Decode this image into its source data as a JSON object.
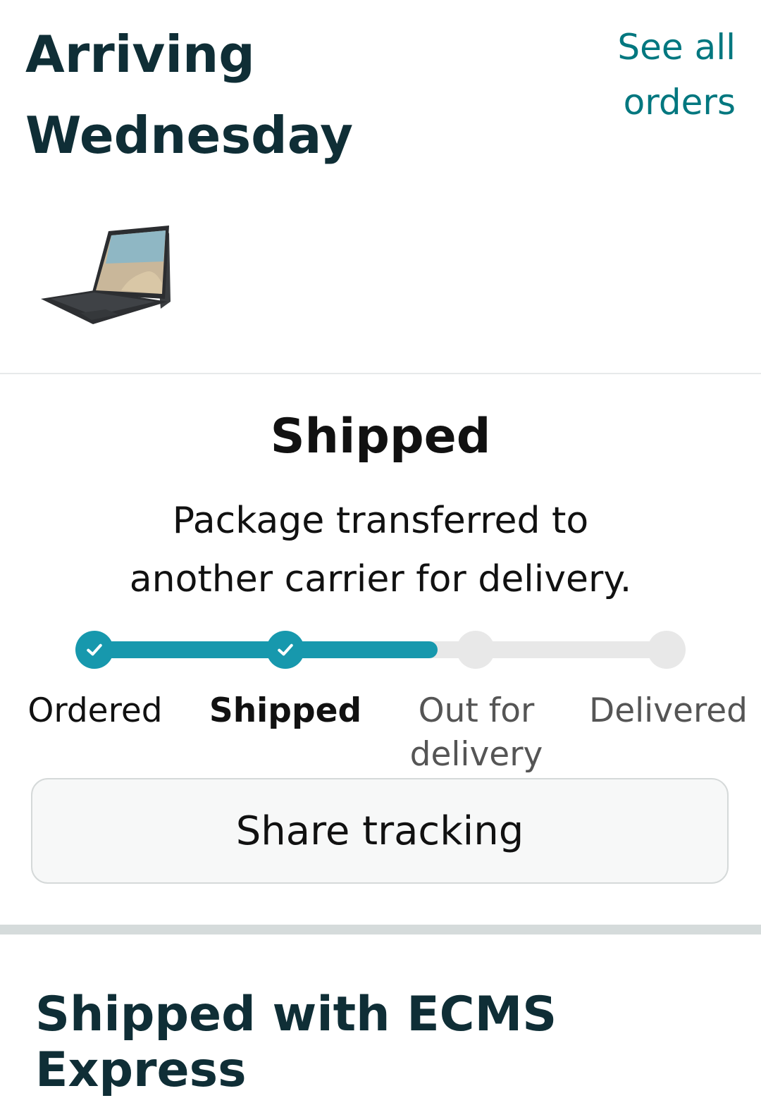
{
  "header": {
    "arriving_line1": "Arriving",
    "arriving_line2": "Wednesday",
    "see_all_line1": "See all",
    "see_all_line2": "orders"
  },
  "product": {
    "image": "laptop-tablet-thumbnail"
  },
  "status": {
    "title": "Shipped",
    "description_line1": "Package transferred to",
    "description_line2": "another carrier for delivery."
  },
  "progress": {
    "accent_color": "#1798ad",
    "inactive_color": "#e8e8e8",
    "fill_fraction": 0.6,
    "steps": [
      {
        "line1": "Ordered",
        "line2": "",
        "state": "complete"
      },
      {
        "line1": "Shipped",
        "line2": "",
        "state": "current"
      },
      {
        "line1": "Out for",
        "line2": "delivery",
        "state": "pending"
      },
      {
        "line1": "Delivered",
        "line2": "",
        "state": "pending"
      }
    ]
  },
  "share_button": {
    "label": "Share tracking"
  },
  "carrier": {
    "title": "Shipped with ECMS Express"
  }
}
